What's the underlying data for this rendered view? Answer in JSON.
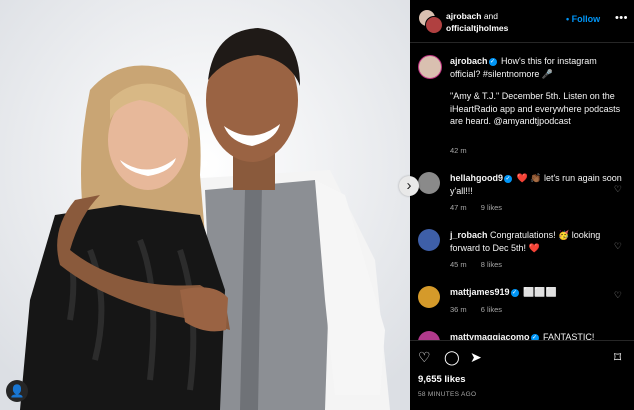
{
  "header": {
    "user1": "ajrobach",
    "connector": "and",
    "user2": "officialtjholmes",
    "follow_label": "Follow",
    "more_icon": "more-horizontal-icon"
  },
  "caption": {
    "user": "ajrobach",
    "line1": "How's this for instagram official? #silentnomore 🎤",
    "line2": "\"Amy & T.J.\" December 5th. Listen on the iHeartRadio app and everywhere podcasts are heard. @amyandtjpodcast",
    "time": "42 m"
  },
  "comments": [
    {
      "user": "hellahgood9",
      "text": "❤️ 👏🏾 let's run again soon y'all!!!",
      "time": "47 m",
      "likes": "9 likes",
      "avatar_color": "#8a8a8a"
    },
    {
      "user": "j_robach",
      "text": "Congratulations! 🥳 looking forward to Dec 5th! ❤️",
      "time": "45 m",
      "likes": "8 likes",
      "avatar_color": "#3e5fa8"
    },
    {
      "user": "mattjames919",
      "text": "⬜⬜⬜",
      "time": "36 m",
      "likes": "6 likes",
      "avatar_color": "#d59a2a"
    },
    {
      "user": "mattymaggiacomo",
      "text": "FANTASTIC!",
      "time": "",
      "likes": "",
      "avatar_color": "#b13a8c"
    }
  ],
  "footer": {
    "likes": "9,655 likes",
    "ago": "58 MINUTES AGO"
  },
  "colors": {
    "accent": "#0095f6",
    "background": "#000000",
    "muted": "#a8a8a8"
  }
}
